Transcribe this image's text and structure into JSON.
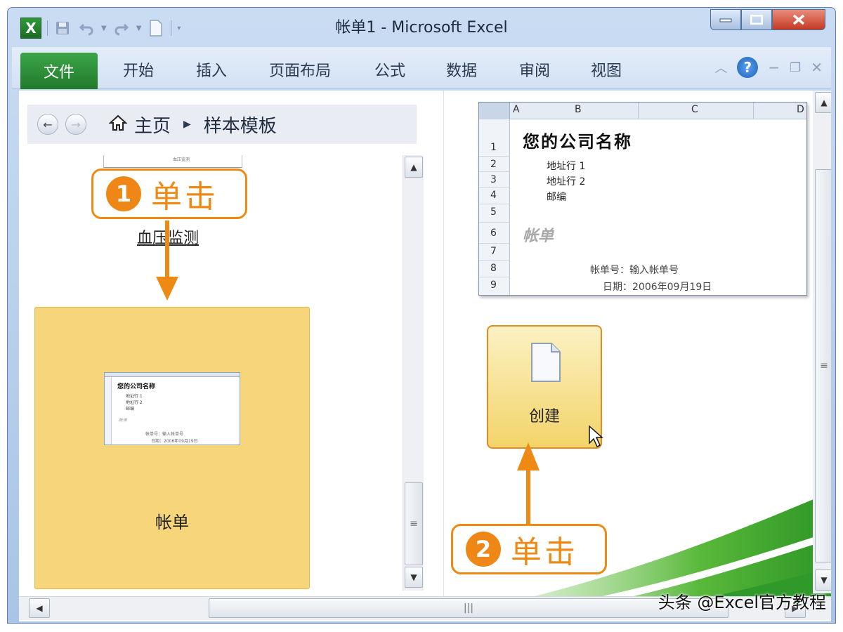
{
  "window": {
    "title": "帐单1  -  Microsoft Excel",
    "logo": "X"
  },
  "ribbon": {
    "file_tab": "文件",
    "tabs": [
      "开始",
      "插入",
      "页面布局",
      "公式",
      "数据",
      "审阅",
      "视图"
    ],
    "help": "?"
  },
  "breadcrumb": {
    "home": "主页",
    "current": "样本模板"
  },
  "templates": {
    "item1_label": "血压监测",
    "item2_label": "帐单",
    "mini_sheet_title": "您的公司名称"
  },
  "preview": {
    "columns": [
      "A",
      "B",
      "C",
      "D"
    ],
    "rows": [
      "1",
      "2",
      "3",
      "4",
      "5",
      "6",
      "7",
      "8",
      "9"
    ],
    "company": "您的公司名称",
    "address1": "地址行 1",
    "address2": "地址行 2",
    "zip": "邮编",
    "bill": "帐单",
    "bill_no": "帐单号：输入帐单号",
    "date": "日期：2006年09月19日"
  },
  "create_button": {
    "label": "创建"
  },
  "callouts": [
    {
      "num": "1",
      "label": "单击"
    },
    {
      "num": "2",
      "label": "单击"
    }
  ],
  "watermark": "头条 @Excel官方教程",
  "colors": {
    "accent_orange": "#ee8a14",
    "file_tab_green": "#2b8f36",
    "selected_item": "#f7d57a"
  }
}
